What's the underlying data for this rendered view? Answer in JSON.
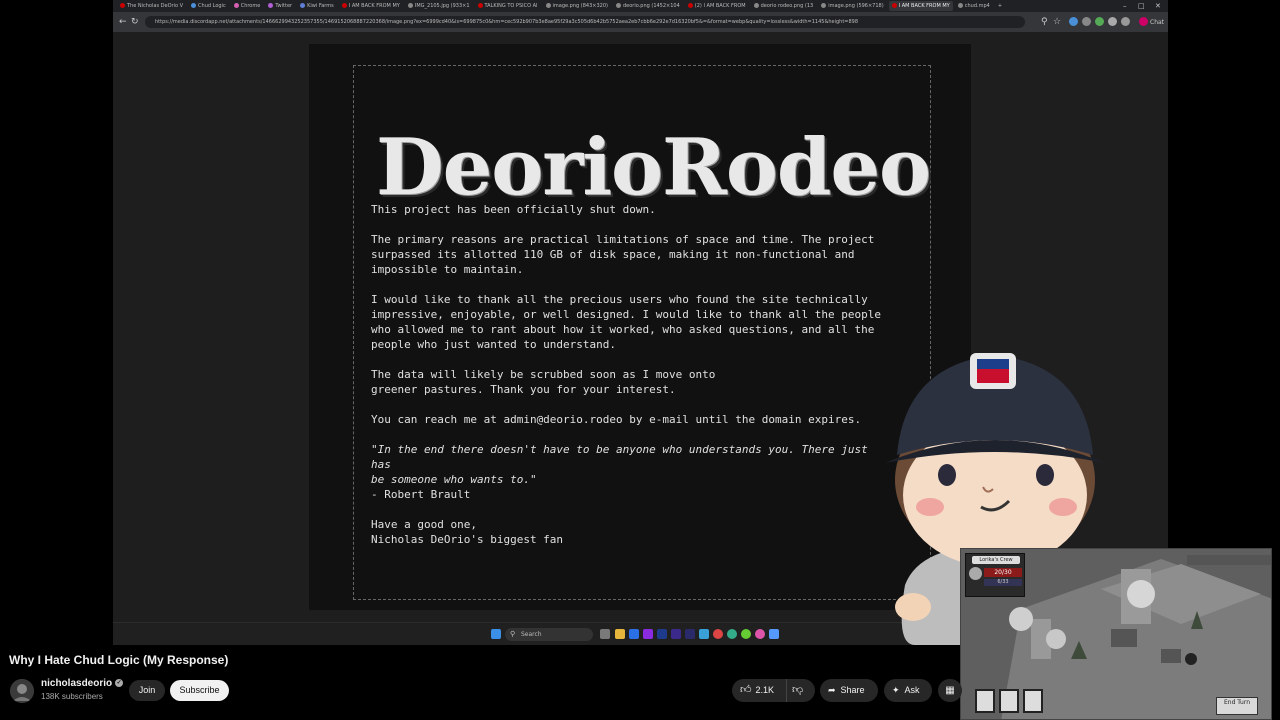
{
  "browser": {
    "tabs": [
      {
        "label": "The Nicholas DeOrio V",
        "color": "#c00"
      },
      {
        "label": "Chud Logic",
        "color": "#4a90d9"
      },
      {
        "label": "Chrome",
        "color": "#d55fb0"
      },
      {
        "label": "Twitter",
        "color": "#b15fd5"
      },
      {
        "label": "Kiwi Farms",
        "color": "#5f7fd5"
      },
      {
        "label": "I AM BACK FROM MY",
        "color": "#c00"
      },
      {
        "label": "IMG_2105.jpg (933×1",
        "color": "#888"
      },
      {
        "label": "TALKING TO PSICO AI",
        "color": "#c00"
      },
      {
        "label": "image.png (843×320)",
        "color": "#888"
      },
      {
        "label": "deorio.png (1452×104",
        "color": "#888"
      },
      {
        "label": "(2) I AM BACK FROM",
        "color": "#c00"
      },
      {
        "label": "deorio rodeo.png (13",
        "color": "#888"
      },
      {
        "label": "image.png (596×718)",
        "color": "#888"
      },
      {
        "label": "I AM BACK FROM MY",
        "color": "#c00"
      },
      {
        "label": "chud.mp4",
        "color": "#888"
      }
    ],
    "active_tab": 13,
    "url": "https://media.discordapp.net/attachments/1466629943252357355/1469152068887220368/image.png?ex=6999cd40&is=699875c0&hm=cec592b907b3e8ae95f29a3c505d6b42b5752aea2eb7cbb6e292e7d16320bf5&=&format=webp&quality=lossless&width=1145&height=898",
    "chat_label": "Chat"
  },
  "notice": {
    "logo": "DeorioRodeo",
    "paragraphs": [
      "This project has been officially shut down.",
      "The primary reasons are practical limitations of space and time. The project\nsurpassed its allotted 110 GB of disk space, making it non-functional and\nimpossible to maintain.",
      "I would like to thank all the precious users who found the site technically\nimpressive, enjoyable, or well designed. I would like to thank all the people\nwho allowed me to rant about how it worked, who asked questions, and all the\npeople who just wanted to understand.",
      "The data will likely be scrubbed soon as I move onto\ngreener pastures. Thank you for your interest.",
      "You can reach me at admin@deorio.rodeo by e-mail until the domain expires."
    ],
    "quote": "\"In the end there doesn't have to be anyone who understands you. There just has\nbe someone who wants to.\"",
    "quote_author": "- Robert Brault",
    "signoff": "Have a good one,\nNicholas DeOrio's biggest fan"
  },
  "taskbar": {
    "search_placeholder": "Search"
  },
  "game": {
    "hud_title": "Lorika's Crew",
    "hp": "20/30",
    "sub": "6/33",
    "end_turn": "End Turn"
  },
  "youtube": {
    "video_title": "Why I Hate Chud Logic (My Response)",
    "channel_name": "nicholasdeorio",
    "subscribers": "138K subscribers",
    "join_label": "Join",
    "subscribe_label": "Subscribe",
    "likes": "2.1K",
    "share_label": "Share",
    "ask_label": "Ask"
  },
  "colors": {
    "page_bg": "#000000",
    "notice_bg": "#111111",
    "notice_text": "#e0e0e0",
    "subscribe_bg": "#f1f1f1",
    "button_bg": "#272727"
  },
  "icons": [
    "back-icon",
    "forward-icon",
    "reload-icon",
    "star-icon",
    "windows-start-icon",
    "search-icon",
    "like-icon",
    "dislike-icon",
    "share-icon",
    "sparkle-icon",
    "save-icon",
    "verified-icon"
  ]
}
